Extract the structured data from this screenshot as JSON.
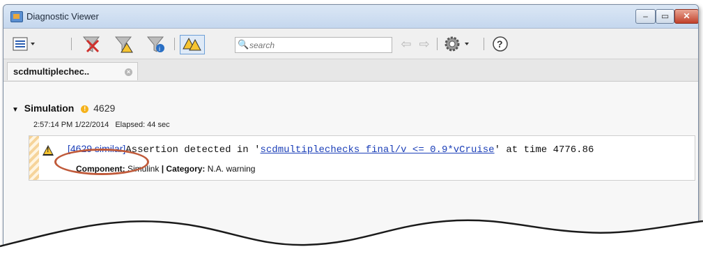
{
  "window": {
    "title": "Diagnostic Viewer",
    "buttons": {
      "minimize": "‒",
      "maximize": "▭",
      "close": "✕"
    }
  },
  "toolbar": {
    "view_menu_icon": "list-view-icon",
    "clear_icon": "clear-filter-icon",
    "errors_icon": "warning-filter-icon",
    "info_icon": "info-filter-icon",
    "group_icon": "group-warnings-icon",
    "search_placeholder": "search",
    "back_icon": "arrow-left-icon",
    "forward_icon": "arrow-right-icon",
    "settings_icon": "gear-icon",
    "help_icon": "help-icon",
    "help_glyph": "?"
  },
  "tab": {
    "label": "scdmultiplechec..",
    "close_glyph": "×"
  },
  "run": {
    "label": "Simulation",
    "count": "4629",
    "time": "2:57:14 PM 1/22/2014",
    "elapsed": "Elapsed: 44 sec"
  },
  "message": {
    "similar": "[4629 similar]",
    "text_before": "Assertion detected in '",
    "block": "scdmultiplechecks final/v <= 0.9*vCruise",
    "text_after": "' at time 4776.86",
    "component_label": "Component:",
    "component_value": "Simulink",
    "separator": "|",
    "category_label": "Category:",
    "category_value": "N.A. warning"
  },
  "colors": {
    "highlight_circle": "#c05a3a",
    "link": "#1b3fb8",
    "warning": "#f6c431"
  }
}
